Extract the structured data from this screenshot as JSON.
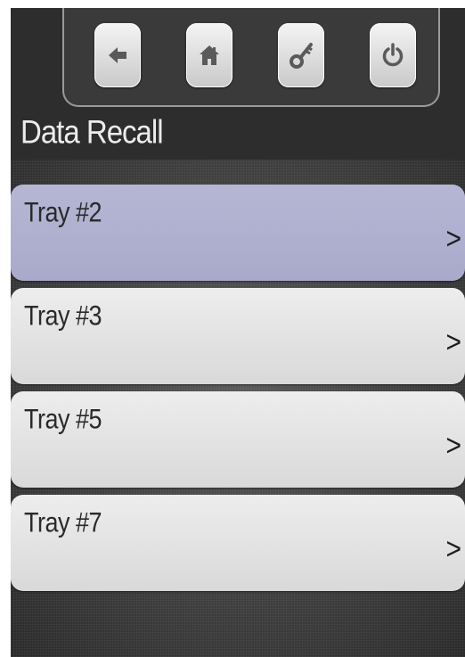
{
  "screen": {
    "title": "Data Recall"
  },
  "toolbar": {
    "buttons": [
      {
        "icon": "back-arrow-icon"
      },
      {
        "icon": "home-icon"
      },
      {
        "icon": "key-icon"
      },
      {
        "icon": "power-icon"
      }
    ]
  },
  "list": {
    "items": [
      {
        "label": "Tray #2",
        "chevron": ">",
        "selected": true
      },
      {
        "label": "Tray #3",
        "chevron": ">",
        "selected": false
      },
      {
        "label": "Tray #5",
        "chevron": ">",
        "selected": false
      },
      {
        "label": "Tray #7",
        "chevron": ">",
        "selected": false
      }
    ]
  },
  "colors": {
    "background": "#2e2e2e",
    "selected_item": "#b0b0d0",
    "item": "#e4e4e4",
    "title_text": "#ececec"
  }
}
